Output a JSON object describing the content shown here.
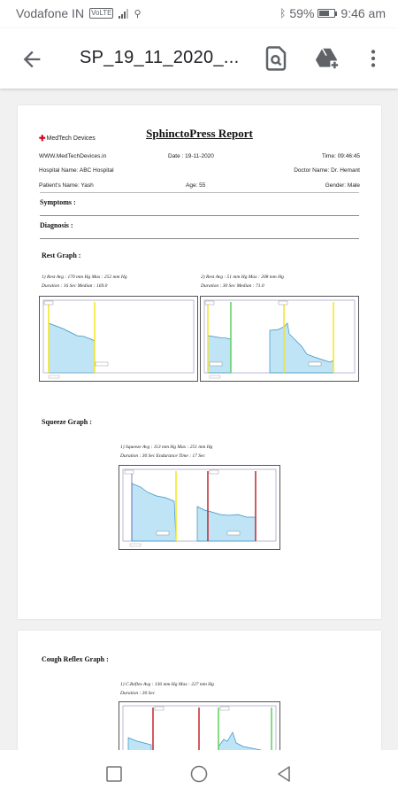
{
  "status_bar": {
    "carrier": "Vodafone IN",
    "network_badge": "VoLTE",
    "battery": "59%",
    "time": "9:46 am"
  },
  "app_bar": {
    "title": "SP_19_11_2020_...",
    "icons": [
      "back-arrow-icon",
      "find-in-page-icon",
      "drive-add-icon",
      "overflow-menu-icon"
    ]
  },
  "report": {
    "logo_text": "MedTech Devices",
    "title": "SphinctoPress Report",
    "website": "WWW.MedTechDevices.in",
    "date": "Date : 19-11-2020",
    "time": "Time: 09:46:45",
    "hospital": "Hospital Name: ABC Hospital",
    "doctor": "Doctor Name: Dr. Hemant",
    "patient": "Patient's Name: Yash",
    "age": "Age: 55",
    "gender": "Gender: Male",
    "symptoms_label": "Symptoms :",
    "diagnosis_label": "Diagnosis :",
    "rest_label": "Rest Graph :",
    "rest1_line1": "1) Rest Avg : 170 mm Hg        Max : 252 mm Hg",
    "rest1_line2": "Duration : 16 Sec        Median : 169.0",
    "rest2_line1": "2) Rest Avg : 51 mm Hg        Max : 208 mm Hg",
    "rest2_line2": "Duration : 30 Sec        Median : 71.0",
    "squeeze_label": "Squeeze Graph :",
    "squeeze_line1": "1) Squeeze Avg : 113 mm Hg          Max : 251 mm Hg",
    "squeeze_line2": "Duration : 30 Sec    Endurance Time : 17 Sec",
    "cough_label": "Cough Reflex Graph :",
    "cough_line1": "1) C.Reflex Avg : 136 mm Hg          Max : 227 mm Hg",
    "cough_line2": "Duration : 30 Sec"
  },
  "colors": {
    "fill": "#bfe4f5",
    "line": "#3a8fc4",
    "marker_yellow": "#f2e51c",
    "marker_green": "#5cd05c",
    "marker_red": "#c0262e",
    "marker_purple": "#6c5bb6"
  }
}
